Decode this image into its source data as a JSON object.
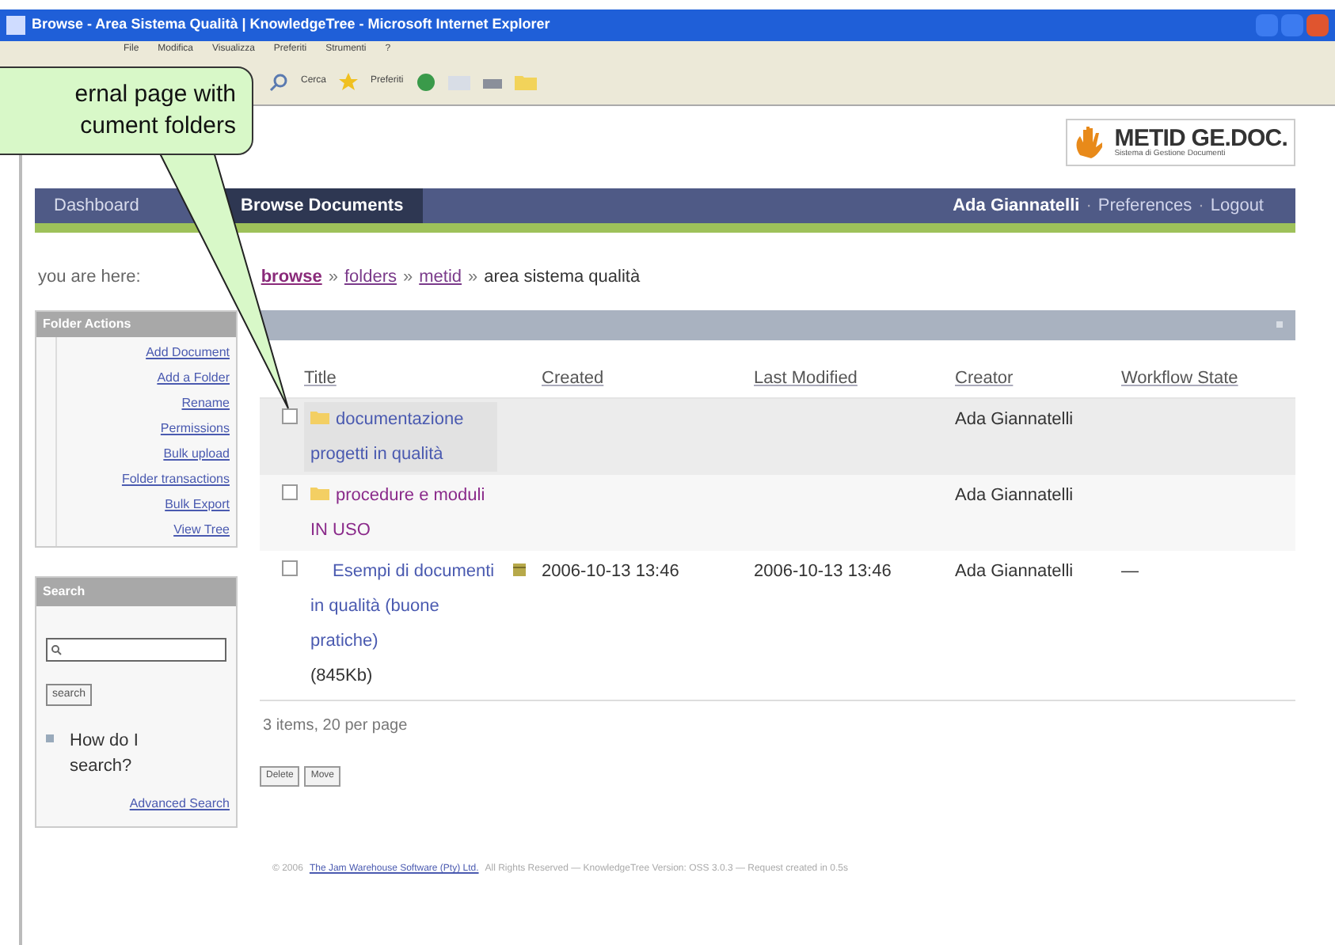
{
  "window": {
    "title": "Browse - Area Sistema Qualità | KnowledgeTree - Microsoft Internet Explorer"
  },
  "menu": [
    "File",
    "Modifica",
    "Visualizza",
    "Preferiti",
    "Strumenti",
    "?"
  ],
  "toolbar": {
    "labels": [
      "Cerca",
      "Preferiti"
    ]
  },
  "callout": {
    "lines": [
      "ernal page with",
      "cument folders"
    ]
  },
  "logo": {
    "title": "METID GE.DOC.",
    "subtitle": "Sistema di Gestione Documenti"
  },
  "nav": {
    "tabs": [
      {
        "label": "Dashboard",
        "selected": false
      },
      {
        "label": "Browse Documents",
        "selected": true
      }
    ],
    "user": "Ada Giannatelli",
    "links": [
      "Preferences",
      "Logout"
    ],
    "separator": "·"
  },
  "breadcrumb": {
    "prefix": "you are here:",
    "separator": "»",
    "items": [
      {
        "label": "browse",
        "link": true
      },
      {
        "label": "folders",
        "link": true
      },
      {
        "label": "metid",
        "link": true
      },
      {
        "label": "area sistema qualità",
        "link": false
      }
    ]
  },
  "sidebar": {
    "folder_actions": {
      "title": "Folder Actions",
      "items": [
        "Add Document",
        "Add a Folder",
        "Rename",
        "Permissions",
        "Bulk upload",
        "Folder transactions",
        "Bulk Export",
        "View Tree"
      ]
    },
    "search": {
      "title": "Search",
      "button": "search",
      "help": "How do I search?",
      "advanced": "Advanced Search"
    }
  },
  "table": {
    "columns": [
      "Title",
      "Created",
      "Last Modified",
      "Creator",
      "Workflow State"
    ],
    "rows": [
      {
        "kind": "folder",
        "checked": false,
        "highlighted": true,
        "title": "documentazione progetti in qualità",
        "creator": "Ada Giannatelli"
      },
      {
        "kind": "folder",
        "checked": false,
        "highlighted": false,
        "title": "procedure e moduli IN USO",
        "creator": "Ada Giannatelli"
      },
      {
        "kind": "document",
        "checked": false,
        "highlighted": false,
        "title": "Esempi di documenti in qualità (buone pratiche)",
        "size": "(845Kb)",
        "created": "2006-10-13 13:46",
        "modified": "2006-10-13 13:46",
        "creator": "Ada Giannatelli",
        "workflow": "—"
      }
    ]
  },
  "summary": "3 items, 20 per page",
  "actions": [
    "Delete",
    "Move"
  ],
  "footer": {
    "prefix": "© 2006",
    "company": "The Jam Warehouse Software (Pty) Ltd.",
    "rest": "All Rights Reserved — KnowledgeTree Version: OSS 3.0.3 — Request created in 0.5s"
  }
}
